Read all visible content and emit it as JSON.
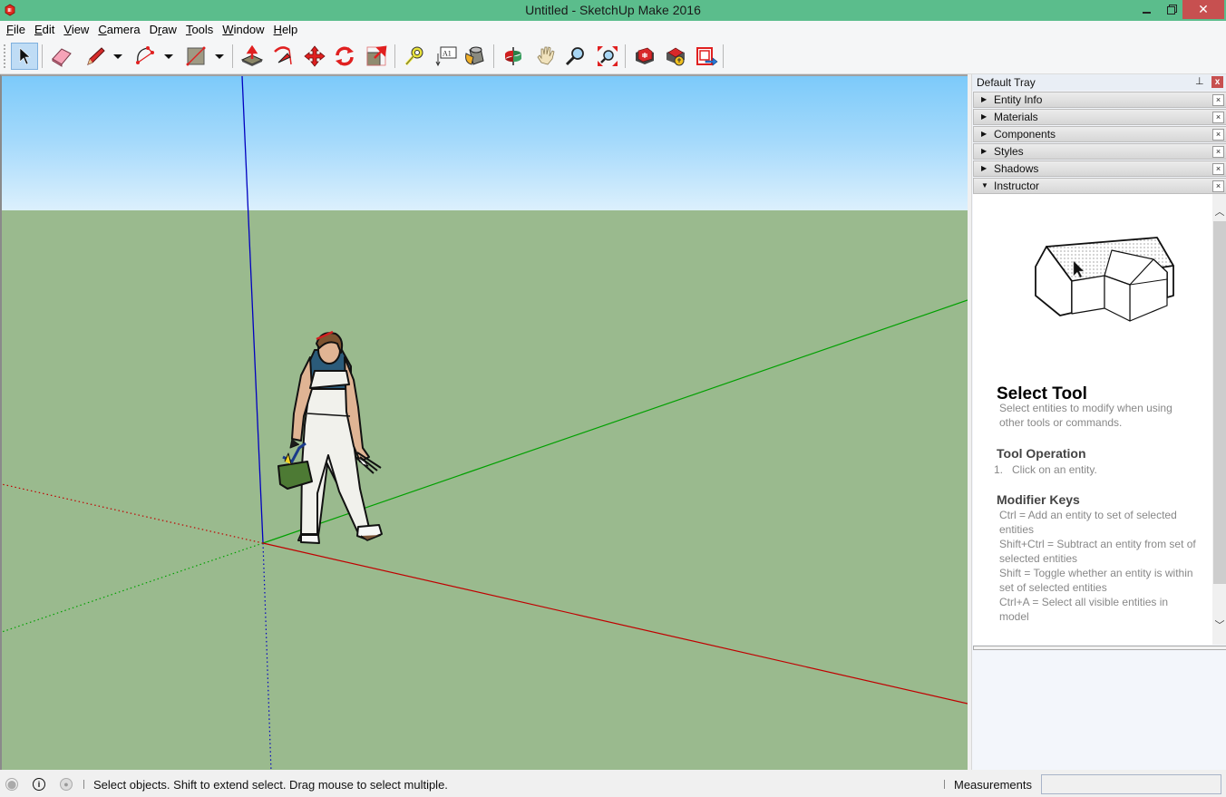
{
  "window": {
    "title": "Untitled - SketchUp Make 2016",
    "minimize_icon": "minimize-icon",
    "maximize_icon": "restore-icon",
    "close_icon": "close-icon"
  },
  "menu": [
    {
      "label": "File",
      "mnemonic": "F",
      "rest": "ile"
    },
    {
      "label": "Edit",
      "mnemonic": "E",
      "rest": "dit"
    },
    {
      "label": "View",
      "mnemonic": "V",
      "rest": "iew"
    },
    {
      "label": "Camera",
      "mnemonic": "C",
      "rest": "amera"
    },
    {
      "label": "Draw",
      "mnemonic": "",
      "rest": "Draw"
    },
    {
      "label": "Tools",
      "mnemonic": "T",
      "rest": "ools"
    },
    {
      "label": "Window",
      "mnemonic": "W",
      "rest": "indow"
    },
    {
      "label": "Help",
      "mnemonic": "H",
      "rest": "elp"
    }
  ],
  "toolbar": {
    "tools": [
      {
        "name": "select",
        "icon": "select-arrow-icon",
        "active": true
      },
      {
        "name": "eraser",
        "icon": "eraser-icon"
      },
      {
        "name": "line",
        "icon": "pencil-icon",
        "dropdown": true
      },
      {
        "name": "arc",
        "icon": "arc-icon",
        "dropdown": true
      },
      {
        "name": "rectangle",
        "icon": "rectangle-icon",
        "dropdown": true
      },
      {
        "name": "push-pull",
        "icon": "push-pull-icon"
      },
      {
        "name": "follow-me",
        "icon": "follow-me-icon"
      },
      {
        "name": "move",
        "icon": "move-icon"
      },
      {
        "name": "rotate",
        "icon": "rotate-icon"
      },
      {
        "name": "scale",
        "icon": "scale-icon"
      },
      {
        "name": "tape-measure",
        "icon": "tape-measure-icon"
      },
      {
        "name": "text",
        "icon": "text-icon",
        "glyph": "A1"
      },
      {
        "name": "paint-bucket",
        "icon": "paint-bucket-icon"
      },
      {
        "name": "orbit",
        "icon": "orbit-icon"
      },
      {
        "name": "pan",
        "icon": "pan-hand-icon"
      },
      {
        "name": "zoom",
        "icon": "zoom-icon"
      },
      {
        "name": "zoom-extents",
        "icon": "zoom-extents-icon"
      },
      {
        "name": "3d-warehouse",
        "icon": "warehouse-icon"
      },
      {
        "name": "extension-warehouse",
        "icon": "extension-warehouse-icon"
      },
      {
        "name": "send-to-layout",
        "icon": "send-to-layout-icon"
      }
    ]
  },
  "viewport": {
    "sky_color": "#7ccafa",
    "ground_color": "#9aba8e",
    "axis_colors": {
      "red": "#c00000",
      "green": "#00a000",
      "blue": "#0000c0"
    },
    "model": "Scale figure (woman in overalls with toolbox)"
  },
  "tray": {
    "title": "Default Tray",
    "pin_icon": "pin-icon",
    "close_label": "x",
    "panels": [
      {
        "label": "Entity Info",
        "expanded": false
      },
      {
        "label": "Materials",
        "expanded": false
      },
      {
        "label": "Components",
        "expanded": false
      },
      {
        "label": "Styles",
        "expanded": false
      },
      {
        "label": "Shadows",
        "expanded": false
      },
      {
        "label": "Instructor",
        "expanded": true
      }
    ],
    "panel_close_label": "×",
    "instructor": {
      "heading": "Select Tool",
      "description": "Select entities to modify when using other tools or commands.",
      "operation_heading": "Tool Operation",
      "operation_steps": [
        "1.   Click on an entity."
      ],
      "modifier_heading": "Modifier Keys",
      "modifier_lines": [
        "Ctrl = Add an entity to set of selected entities",
        "Shift+Ctrl = Subtract an entity from set of selected entities",
        "Shift = Toggle whether an entity is within set of selected entities",
        "Ctrl+A = Select all visible entities in model"
      ]
    }
  },
  "status": {
    "message": "Select objects. Shift to extend select. Drag mouse to select multiple.",
    "icons": [
      "geo-location-icon",
      "credits-info-icon",
      "user-account-icon"
    ],
    "measurements_label": "Measurements",
    "measurements_value": ""
  }
}
